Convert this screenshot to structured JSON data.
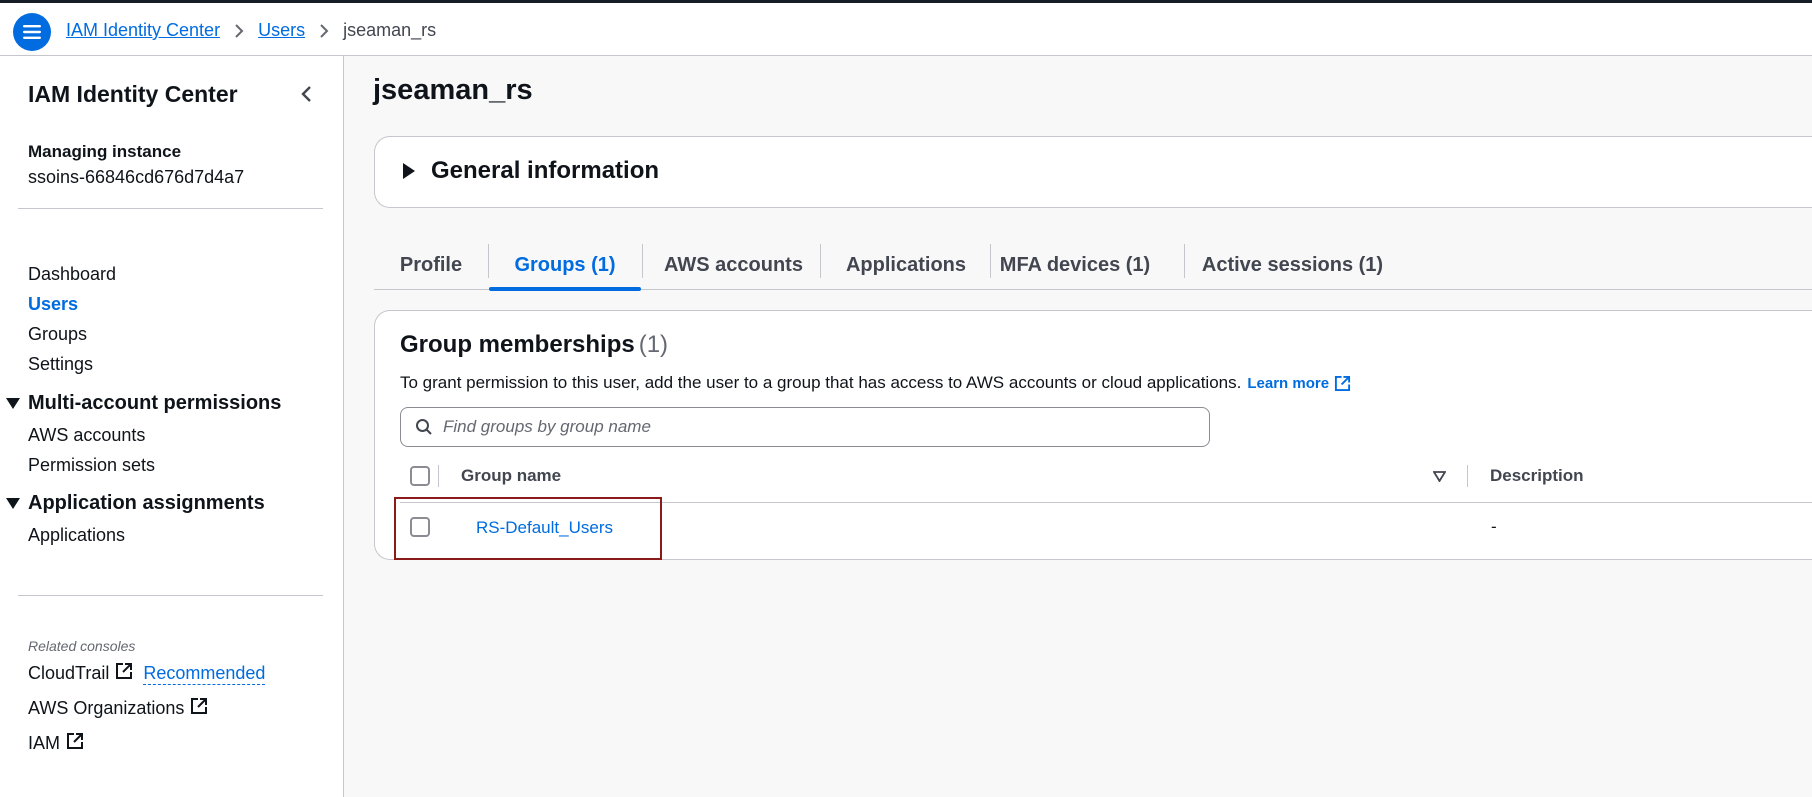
{
  "breadcrumb": {
    "items": [
      "IAM Identity Center",
      "Users"
    ],
    "current": "jseaman_rs"
  },
  "sidebar": {
    "title": "IAM Identity Center",
    "instance_label": "Managing instance",
    "instance_value": "ssoins-66846cd676d7d4a7",
    "nav": [
      "Dashboard",
      "Users",
      "Groups",
      "Settings"
    ],
    "active_nav": "Users",
    "sections": [
      {
        "title": "Multi-account permissions",
        "items": [
          "AWS accounts",
          "Permission sets"
        ]
      },
      {
        "title": "Application assignments",
        "items": [
          "Applications"
        ]
      }
    ],
    "related_label": "Related consoles",
    "related": [
      {
        "label": "CloudTrail",
        "badge": "Recommended"
      },
      {
        "label": "AWS Organizations"
      },
      {
        "label": "IAM"
      }
    ]
  },
  "page": {
    "title": "jseaman_rs",
    "general_info": "General information"
  },
  "tabs": [
    "Profile",
    "Groups (1)",
    "AWS accounts",
    "Applications",
    "MFA devices (1)",
    "Active sessions (1)"
  ],
  "active_tab": "Groups (1)",
  "groups_panel": {
    "title": "Group memberships",
    "count": "(1)",
    "description": "To grant permission to this user, add the user to a group that has access to AWS accounts or cloud applications.",
    "learn_more": "Learn more",
    "search_placeholder": "Find groups by group name",
    "columns": [
      "Group name",
      "Description"
    ],
    "rows": [
      {
        "name": "RS-Default_Users",
        "description": "-"
      }
    ]
  },
  "colors": {
    "accent": "#006ce0",
    "highlight_border": "#8b1a1a"
  }
}
